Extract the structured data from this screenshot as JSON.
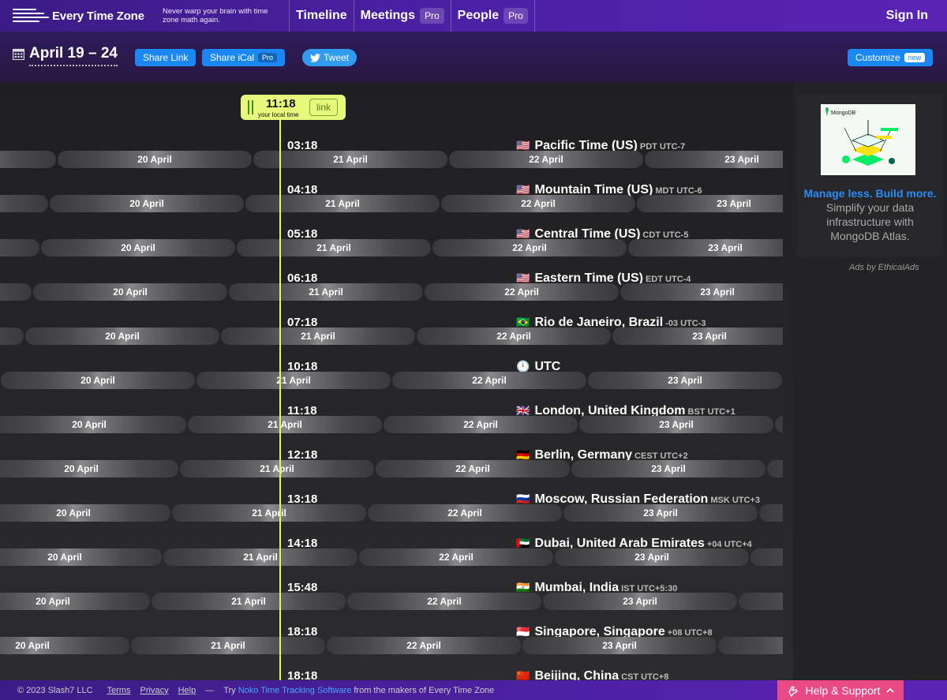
{
  "header": {
    "logo_title": "Every Time Zone",
    "tagline": "Never warp your brain with time zone math again.",
    "nav": [
      {
        "label": "Timeline",
        "badge": ""
      },
      {
        "label": "Meetings",
        "badge": "Pro"
      },
      {
        "label": "People",
        "badge": "Pro"
      }
    ],
    "signin": "Sign In"
  },
  "toolbar": {
    "date_range": "April 19 – 24",
    "share_link": "Share Link",
    "share_ical": "Share iCal",
    "share_ical_badge": "Pro",
    "tweet": "Tweet",
    "customize": "Customize",
    "customize_badge": "new"
  },
  "now": {
    "time": "11:18",
    "caption": "your local time",
    "link_label": "link"
  },
  "rows": [
    {
      "time": "03:18",
      "flag": "🇺🇸",
      "zone": "Pacific Time (US)",
      "abbr": "PDT UTC-7",
      "offset": 0
    },
    {
      "time": "04:18",
      "flag": "🇺🇸",
      "zone": "Mountain Time (US)",
      "abbr": "MDT UTC-6",
      "offset": -10
    },
    {
      "time": "05:18",
      "flag": "🇺🇸",
      "zone": "Central Time (US)",
      "abbr": "CDT UTC-5",
      "offset": -21
    },
    {
      "time": "06:18",
      "flag": "🇺🇸",
      "zone": "Eastern Time (US)",
      "abbr": "EDT UTC-4",
      "offset": -31
    },
    {
      "time": "07:18",
      "flag": "🇧🇷",
      "zone": "Rio de Janeiro, Brazil",
      "abbr": "-03 UTC-3",
      "offset": -41
    },
    {
      "time": "10:18",
      "flag": "🕛",
      "zone": "UTC",
      "abbr": "",
      "offset": -72
    },
    {
      "time": "11:18",
      "flag": "🇬🇧",
      "zone": "London, United Kingdom",
      "abbr": "BST UTC+1",
      "offset": -83
    },
    {
      "time": "12:18",
      "flag": "🇩🇪",
      "zone": "Berlin, Germany",
      "abbr": "CEST UTC+2",
      "offset": -93
    },
    {
      "time": "13:18",
      "flag": "🇷🇺",
      "zone": "Moscow, Russian Federation",
      "abbr": "MSK UTC+3",
      "offset": -103
    },
    {
      "time": "14:18",
      "flag": "🇦🇪",
      "zone": "Dubai, United Arab Emirates",
      "abbr": "+04 UTC+4",
      "offset": -114
    },
    {
      "time": "15:48",
      "flag": "🇮🇳",
      "zone": "Mumbai, India",
      "abbr": "IST UTC+5:30",
      "offset": -129
    },
    {
      "time": "18:18",
      "flag": "🇸🇬",
      "zone": "Singapore, Singapore",
      "abbr": "+08 UTC+8",
      "offset": -155
    },
    {
      "time": "18:18",
      "flag": "🇨🇳",
      "zone": "Beijing, China",
      "abbr": "CST UTC+8",
      "offset": -155
    }
  ],
  "day_labels": [
    "20 April",
    "21 April",
    "22 April",
    "23 April"
  ],
  "ad": {
    "brand": "MongoDB",
    "headline": "Manage less. Build more.",
    "body": " Simplify your data infrastructure with MongoDB Atlas.",
    "attribution": "Ads by EthicalAds"
  },
  "footer": {
    "copyright": "© 2023 Slash7 LLC",
    "links": [
      "Terms",
      "Privacy",
      "Help"
    ],
    "dash": "—",
    "try_prefix": "Try",
    "noko": "Noko Time Tracking Software",
    "suffix": "from the makers of Every Time Zone",
    "help_button": "Help & Support"
  },
  "colors": {
    "accent_blue": "#1b87f3",
    "now_line": "#e3f75a",
    "help_pink": "#e84a84"
  }
}
